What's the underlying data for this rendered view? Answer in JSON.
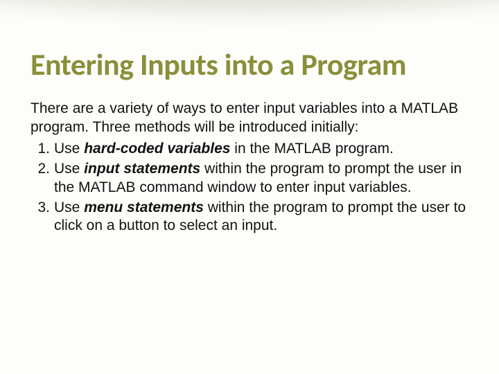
{
  "slide": {
    "title": "Entering Inputs into a Program",
    "intro": "There are a variety of ways to enter input variables into a MATLAB program.  Three methods will be introduced initially:",
    "items": [
      {
        "pre": "Use ",
        "emph": "hard-coded variables",
        "post": " in the MATLAB program."
      },
      {
        "pre": "Use ",
        "emph": "input statements",
        "post": " within the program to prompt the user in the MATLAB command window to enter input variables."
      },
      {
        "pre": "Use ",
        "emph": "menu statements",
        "post": " within the program to prompt the user to click on a button to select an input."
      }
    ]
  }
}
